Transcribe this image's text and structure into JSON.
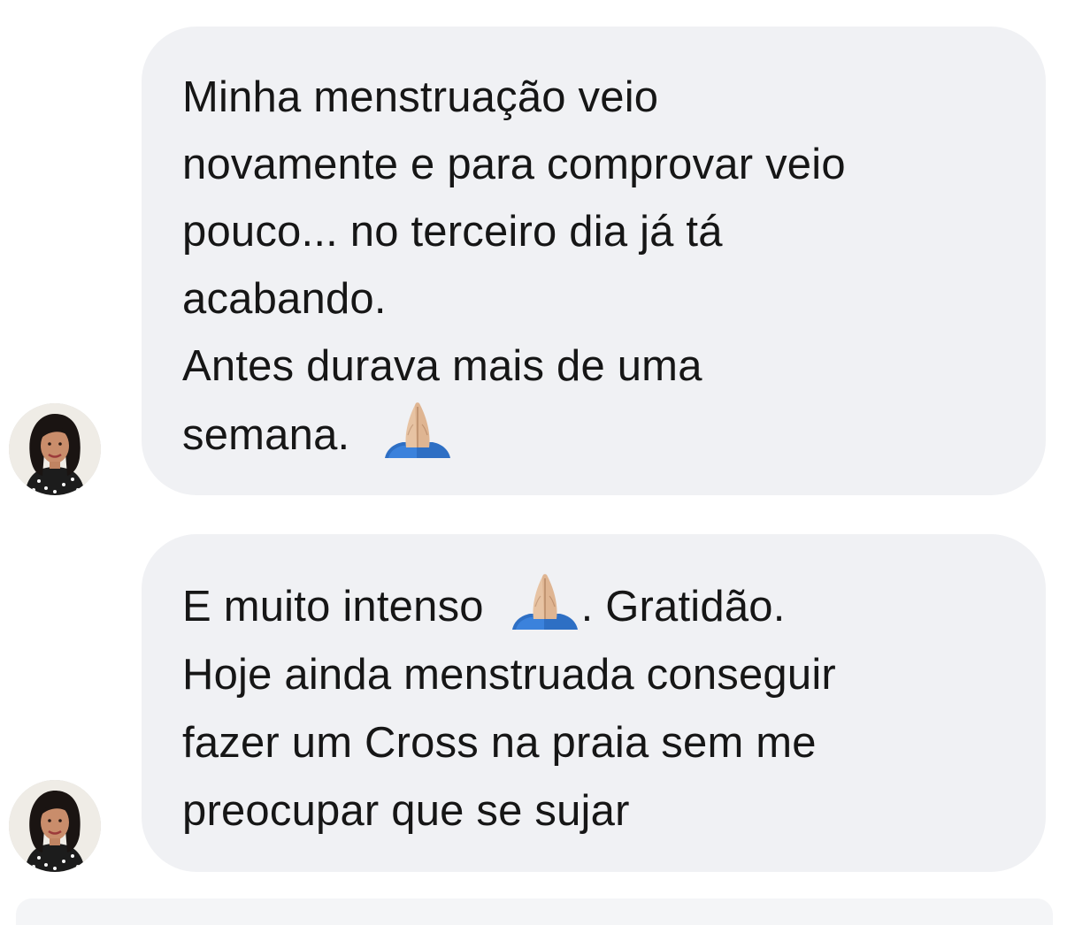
{
  "thread": {
    "messages": [
      {
        "lines": [
          "Minha menstruação veio",
          "novamente e para comprovar veio",
          "pouco... no terceiro dia já tá",
          "acabando.",
          "Antes durava mais de uma"
        ],
        "last_line_text": "semana.",
        "emoji": "folded-hands-icon"
      },
      {
        "first_line_before": "E muito intenso",
        "first_line_after": ". Gratidão.",
        "emoji": "folded-hands-icon",
        "lines": [
          "Hoje ainda menstruada conseguir",
          "fazer um Cross na praia sem me",
          "preocupar que se sujar"
        ]
      }
    ]
  },
  "colors": {
    "bubble": "#f0f1f4",
    "text": "#161616",
    "background": "#ffffff"
  }
}
